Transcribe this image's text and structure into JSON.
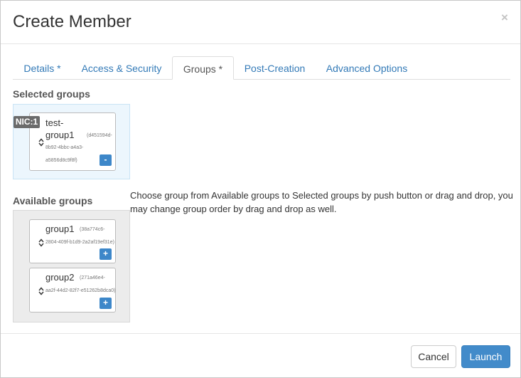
{
  "dialog": {
    "title": "Create Member",
    "close_glyph": "×"
  },
  "tabs": [
    {
      "label": "Details *"
    },
    {
      "label": "Access & Security"
    },
    {
      "label": "Groups *"
    },
    {
      "label": "Post-Creation"
    },
    {
      "label": "Advanced Options"
    }
  ],
  "selected": {
    "heading": "Selected groups",
    "nic_badge": "NIC:1",
    "items": [
      {
        "name_line1": "test-",
        "name_line2": "group1",
        "uuid_a": "(d451594d-",
        "uuid_b": "8b92-4bbc-a4a3-",
        "uuid_c": "a5856d8c9f8f)",
        "button": "-"
      }
    ]
  },
  "available": {
    "heading": "Available groups",
    "items": [
      {
        "name": "group1",
        "uuid_a": "(38a774c6-",
        "uuid_b": "2804-409f-b1d9-2a2af19ef31e)",
        "button": "+"
      },
      {
        "name": "group2",
        "uuid_a": "(271a46e4-",
        "uuid_b": "aa2f-44d2-82f7-e51262b8dca0)",
        "button": "+"
      }
    ]
  },
  "help_text": "Choose group from Available groups to Selected groups by push button or drag and drop, you may change group order by drag and drop as well.",
  "footer": {
    "cancel": "Cancel",
    "launch": "Launch"
  },
  "colors": {
    "primary": "#428bca",
    "link": "#337ab7",
    "selected_bg": "#ecf6fd",
    "available_bg": "#ececec"
  }
}
